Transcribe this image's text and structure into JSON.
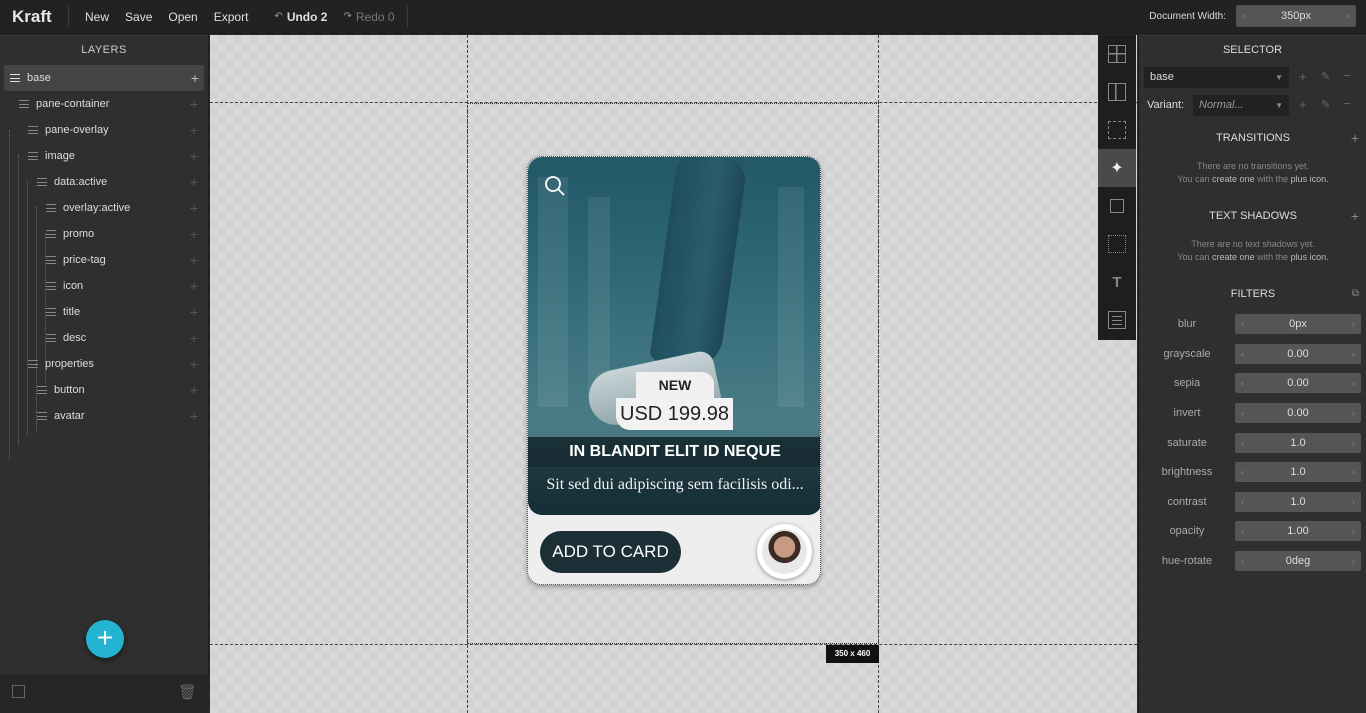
{
  "app": {
    "name": "Kraft"
  },
  "toolbar": {
    "new": "New",
    "save": "Save",
    "open": "Open",
    "export": "Export",
    "undo": "Undo 2",
    "redo": "Redo 0",
    "doc_width_label": "Document Width:",
    "doc_width_value": "350px"
  },
  "layers": {
    "title": "LAYERS",
    "items": [
      {
        "label": "base",
        "indent": 0,
        "selected": true
      },
      {
        "label": "pane-container",
        "indent": 1
      },
      {
        "label": "pane-overlay",
        "indent": 2
      },
      {
        "label": "image",
        "indent": 2
      },
      {
        "label": "data:active",
        "indent": 3
      },
      {
        "label": "overlay:active",
        "indent": 4
      },
      {
        "label": "promo",
        "indent": 4
      },
      {
        "label": "price-tag",
        "indent": 4
      },
      {
        "label": "icon",
        "indent": 4
      },
      {
        "label": "title",
        "indent": 4
      },
      {
        "label": "desc",
        "indent": 4
      },
      {
        "label": "properties",
        "indent": 2
      },
      {
        "label": "button",
        "indent": 3
      },
      {
        "label": "avatar",
        "indent": 3
      }
    ]
  },
  "canvas": {
    "size_badge": "350 x 460"
  },
  "card": {
    "badge_new": "NEW",
    "price": "USD 199.98",
    "title": "IN BLANDIT ELIT ID NEQUE",
    "desc": "Sit sed dui adipiscing sem facilisis odi...",
    "button": "ADD TO CARD"
  },
  "right": {
    "selector_title": "SELECTOR",
    "selector_value": "base",
    "variant_label": "Variant:",
    "variant_value": "Normal...",
    "transitions_title": "TRANSITIONS",
    "transitions_empty_1": "There are no transitions yet.",
    "transitions_empty_2a": "You can ",
    "transitions_empty_2b": "create one",
    "transitions_empty_2c": " with the ",
    "transitions_empty_2d": "plus icon.",
    "shadows_title": "TEXT SHADOWS",
    "shadows_empty_1": "There are no text shadows yet.",
    "filters_title": "FILTERS",
    "filters": [
      {
        "label": "blur",
        "value": "0px"
      },
      {
        "label": "grayscale",
        "value": "0.00"
      },
      {
        "label": "sepia",
        "value": "0.00"
      },
      {
        "label": "invert",
        "value": "0.00"
      },
      {
        "label": "saturate",
        "value": "1.0"
      },
      {
        "label": "brightness",
        "value": "1.0"
      },
      {
        "label": "contrast",
        "value": "1.0"
      },
      {
        "label": "opacity",
        "value": "1.00"
      },
      {
        "label": "hue-rotate",
        "value": "0deg"
      }
    ]
  },
  "colors": {
    "accent": "#22b4d1",
    "card_dark": "#1d2f36"
  }
}
